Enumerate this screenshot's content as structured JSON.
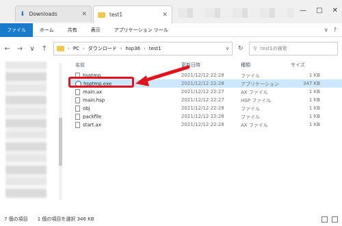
{
  "tabs": [
    {
      "title": "Downloads"
    },
    {
      "title": "test1"
    }
  ],
  "window_controls": {
    "minimize": "—",
    "maximize": "□",
    "close": "✕"
  },
  "ribbon": {
    "items": [
      "ファイル",
      "ホーム",
      "共有",
      "表示",
      "アプリケーション ツール"
    ]
  },
  "nav": {
    "back": "←",
    "forward": "→",
    "up": "↑",
    "recent": "∨"
  },
  "address": {
    "parts": [
      "PC",
      "ダウンロード",
      "hsp36",
      "test1"
    ],
    "dropdown": "∨",
    "refresh": "↻"
  },
  "search": {
    "placeholder": "test1の検索"
  },
  "columns": {
    "name": "名前",
    "date": "更新日時",
    "type": "種類",
    "size": "サイズ"
  },
  "files": [
    {
      "name": "hsptmp",
      "date": "2021/12/12 22:28",
      "type": "ファイル",
      "size": "1 KB",
      "icon": "file-icon"
    },
    {
      "name": "hsptmp.exe",
      "date": "2021/12/12 22:28",
      "type": "アプリケーション",
      "size": "347 KB",
      "icon": "exe-icon",
      "selected": true
    },
    {
      "name": "main.ax",
      "date": "2021/12/12 22:27",
      "type": "AX ファイル",
      "size": "1 KB",
      "icon": "file-icon"
    },
    {
      "name": "main.hsp",
      "date": "2021/12/12 22:27",
      "type": "HSP ファイル",
      "size": "1 KB",
      "icon": "file-icon"
    },
    {
      "name": "obj",
      "date": "2021/12/12 22:28",
      "type": "ファイル",
      "size": "1 KB",
      "icon": "file-icon"
    },
    {
      "name": "packfile",
      "date": "2021/12/12 22:28",
      "type": "ファイル",
      "size": "1 KB",
      "icon": "file-icon"
    },
    {
      "name": "start.ax",
      "date": "2021/12/12 22:28",
      "type": "AX ファイル",
      "size": "1 KB",
      "icon": "file-icon"
    }
  ],
  "status": {
    "count": "7 個の項目",
    "selection": "1 個の項目を選択  346 KB"
  },
  "colors": {
    "accent": "#1979ca",
    "highlight": "#e0141a",
    "selection": "#cce8ff"
  }
}
